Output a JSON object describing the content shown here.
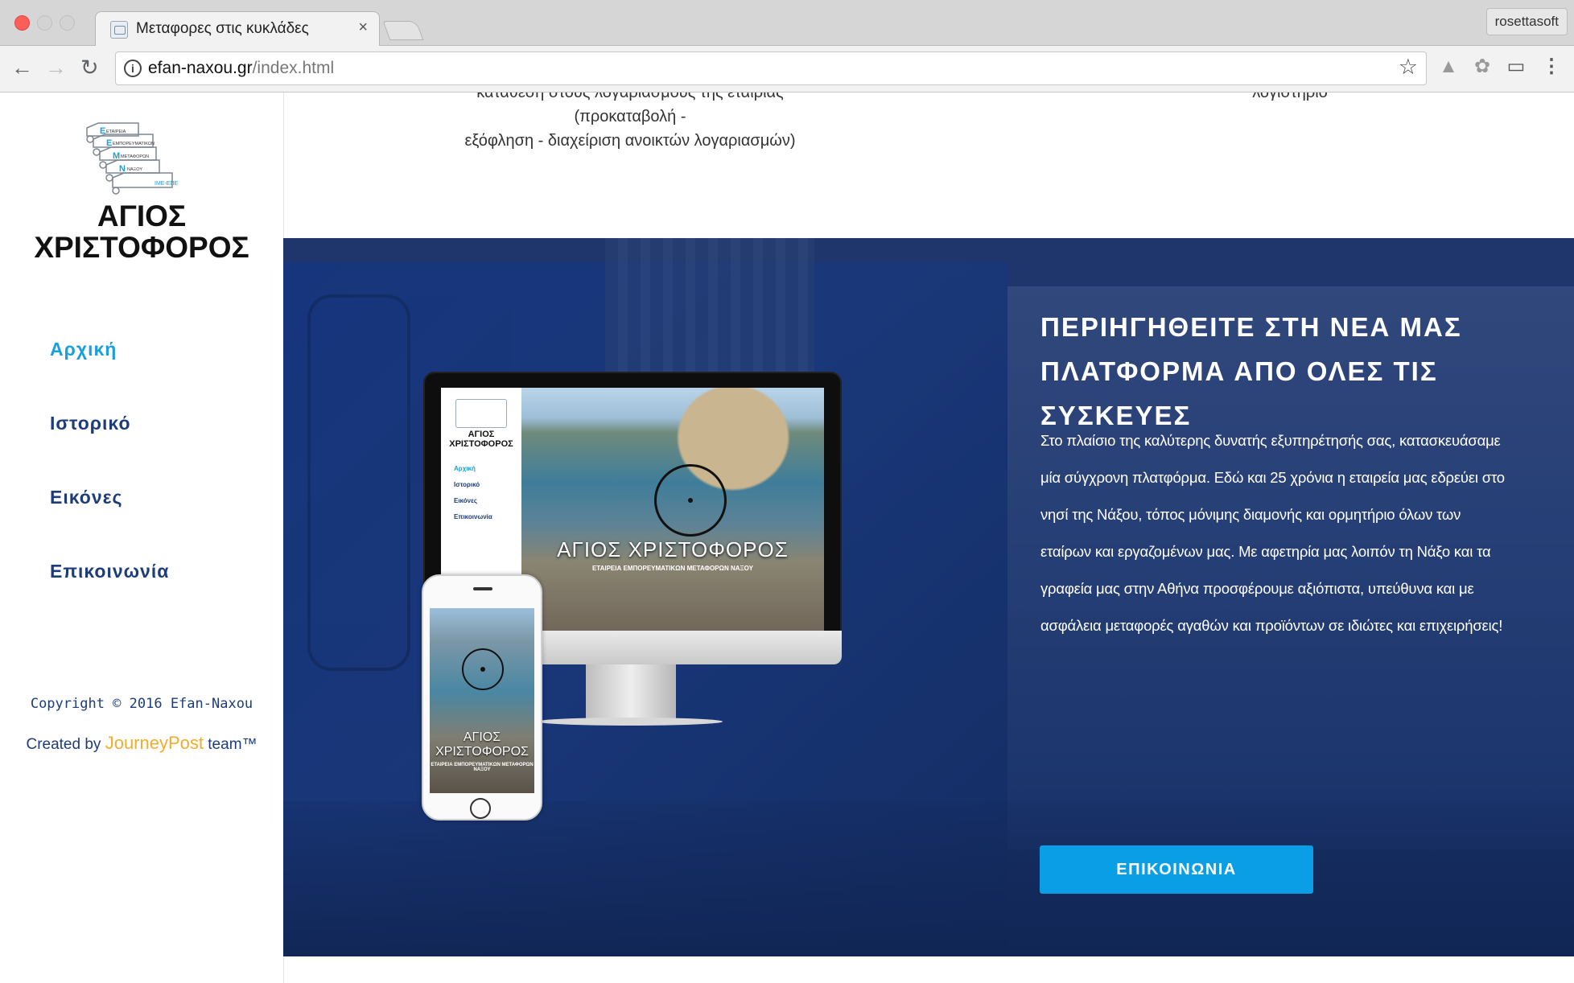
{
  "browser": {
    "tab_title": "Μεταφορες στις κυκλάδες",
    "tab_close": "×",
    "profile": "rosettasoft",
    "url_domain": "efan-naxou.gr",
    "url_path": "/index.html",
    "icons": [
      "back-icon",
      "forward-icon",
      "reload-icon",
      "info-icon",
      "star-icon",
      "drive-icon",
      "extension-icon",
      "cast-icon",
      "menu-icon"
    ]
  },
  "sidebar": {
    "logo_line1": "ΑΓΙΟΣ",
    "logo_line2": "ΧΡΙΣΤΟΦΟΡΟΣ",
    "logo_words": [
      "ΕΤΑΙΡΕΙΑ",
      "ΕΜΠΟΡΕΥΜΑΤΙΚΩΝ",
      "ΜΕΤΑΦΟΡΩΝ",
      "ΝΑΞΟΥ",
      "ΙΜΕ-ΕΠΕ"
    ],
    "menu": [
      {
        "label": "Αρχική",
        "active": true
      },
      {
        "label": "Ιστορικό",
        "active": false
      },
      {
        "label": "Εικόνες",
        "active": false
      },
      {
        "label": "Επικοινωνία",
        "active": false
      }
    ],
    "copyright": "Copyright © 2016 Efan-Naxou",
    "credits_prefix": "Created by",
    "credits_brand": "JourneyPost",
    "credits_suffix": "team™"
  },
  "top_strip": {
    "col1_line1": "κατάθεση στους λογαριασμούς της εταιρίας (προκαταβολή -",
    "col1_line2": "εξόφληση - διαχείριση ανοικτών λογαριασμών)",
    "col2_line1": "λογιστήριο"
  },
  "hero": {
    "heading": "ΠΕΡΙΗΓΗΘΕΙΤΕ ΣΤΗ ΝΕΑ ΜΑΣ ΠΛΑΤΦΟΡΜΑ ΑΠΟ ΟΛΕΣ ΤΙΣ ΣΥΣΚΕΥΕΣ",
    "body": "Στο πλαίσιο της καλύτερης δυνατής εξυπηρέτησής σας, κατασκευάσαμε μία σύγχρονη πλατφόρμα. Εδώ και 25 χρόνια η εταιρεία μας εδρεύει στο νησί της Νάξου, τόπος μόνιμης διαμονής και ορμητήριο όλων των εταίρων και εργαζομένων μας. Με αφετηρία μας λοιπόν τη Νάξο και τα γραφεία μας στην Αθήνα προσφέρουμε αξιόπιστα, υπεύθυνα και με ασφάλεια μεταφορές αγαθών και προϊόντων σε ιδιώτες και επιχειρήσεις!",
    "cta": "ΕΠΙΚΟΙΝΩΝΙΑ",
    "monitor_title": "ΑΓΙΟΣ ΧΡΙΣΤΟΦΟΡΟΣ",
    "monitor_subtitle": "ΕΤΑΙΡΕΙΑ ΕΜΠΟΡΕΥΜΑΤΙΚΩΝ ΜΕΤΑΦΟΡΩΝ ΝΑΞΟΥ",
    "mini_logo_line1": "ΑΓΙΟΣ",
    "mini_logo_line2": "ΧΡΙΣΤΟΦΟΡΟΣ",
    "mini_menu": [
      "Αρχική",
      "Ιστορικό",
      "Εικόνες",
      "Επικοινωνία"
    ],
    "phone_title_1": "ΑΓΙΟΣ",
    "phone_title_2": "ΧΡΙΣΤΟΦΟΡΟΣ",
    "phone_subtitle": "ΕΤΑΙΡΕΙΑ ΕΜΠΟΡΕΥΜΑΤΙΚΩΝ ΜΕΤΑΦΟΡΩΝ ΝΑΞΟΥ"
  },
  "colors": {
    "accent": "#1a9fde",
    "nav_text": "#1d3d7a",
    "hero_overlay": "#1e3566",
    "button": "#0a9ee6",
    "brand_orange": "#f0ad2f"
  }
}
